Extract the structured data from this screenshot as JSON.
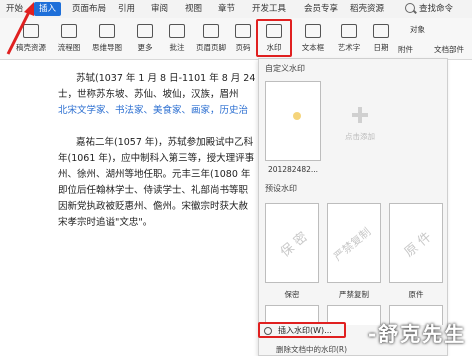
{
  "menu": {
    "tabs": [
      "开始",
      "插入",
      "页面布局",
      "引用",
      "审阅",
      "视图",
      "章节",
      "开发工具",
      "会员专享",
      "稻壳资源"
    ],
    "active_tab": "插入",
    "search_label": "查找命令",
    "accent_color": "#1e6fd9"
  },
  "ribbon": {
    "buttons": [
      "稿壳资源",
      "流程图",
      "思维导图",
      "更多",
      "批注",
      "页眉页脚",
      "页码",
      "水印",
      "文本框",
      "艺术字",
      "日期",
      "附件",
      "文档部件"
    ],
    "right_small": [
      "对象"
    ]
  },
  "document": {
    "lines": [
      "苏轼(1037 年 1 月 8 日-1101 年 8 月 24 日",
      "士，世称苏东坡、苏仙、坡仙，汉族，眉州",
      "北宋文学家、书法家、美食家、画家，历史治",
      "嘉祐二年(1057 年)，苏轼参加殿试中乙科",
      "年(1061 年)，应中制科入第三等，授大理评事",
      "州、徐州、湖州等地任职。元丰三年(1080 年",
      "即位后任翰林学士、侍读学士、礼部尚书等职",
      "因新党执政被贬惠州、儋州。宋徽宗时获大赦",
      "宋孝宗时追谥\"文忠\"。"
    ]
  },
  "watermark_panel": {
    "custom_title": "自定义水印",
    "custom_item_caption": "201282482...",
    "add_caption": "点击添加",
    "preset_title": "预设水印",
    "presets": [
      {
        "text": "保 密",
        "caption": "保密"
      },
      {
        "text": "严禁复制",
        "caption": "严禁复制"
      },
      {
        "text": "原 件",
        "caption": "原件"
      }
    ],
    "insert_label": "插入水印(W)...",
    "delete_label": "删除文档中的水印(R)"
  },
  "brand": "-舒克先生"
}
